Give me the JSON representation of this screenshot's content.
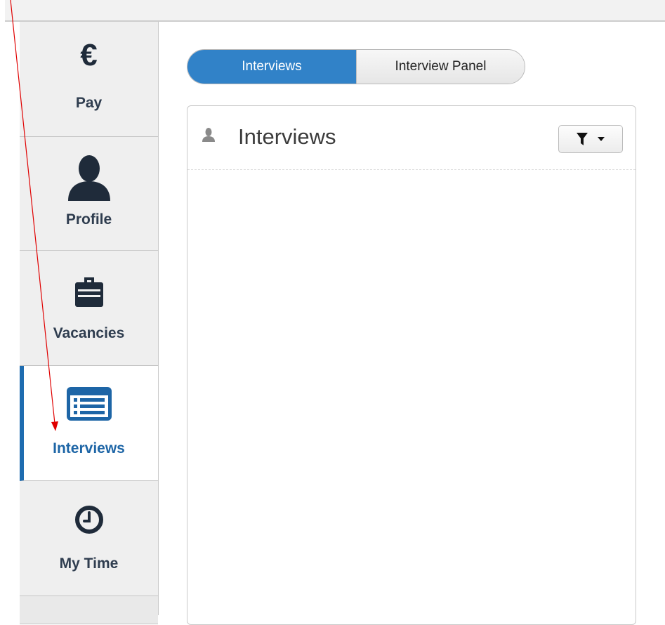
{
  "sidebar": {
    "items": [
      {
        "label": "Pay",
        "icon": "euro-icon",
        "icon_glyph": "€",
        "active": false
      },
      {
        "label": "Profile",
        "icon": "person-icon",
        "active": false
      },
      {
        "label": "Vacancies",
        "icon": "briefcase-icon",
        "active": false
      },
      {
        "label": "Interviews",
        "icon": "list-icon",
        "active": true
      },
      {
        "label": "My Time",
        "icon": "clock-icon",
        "active": false
      }
    ]
  },
  "toggle": {
    "options": [
      {
        "label": "Interviews",
        "selected": true
      },
      {
        "label": "Interview Panel",
        "selected": false
      }
    ]
  },
  "panel": {
    "title": "Interviews",
    "title_icon": "person-icon",
    "filter_icon": "filter-icon",
    "dropdown_icon": "caret-down-icon"
  },
  "annotation": {
    "type": "arrow",
    "color": "#e00000"
  },
  "colors": {
    "accent": "#3182c8",
    "active_border": "#1e6cb0",
    "active_text": "#1d65a6",
    "nav_bg": "#efefef",
    "nav_text": "#2f3d4f"
  }
}
